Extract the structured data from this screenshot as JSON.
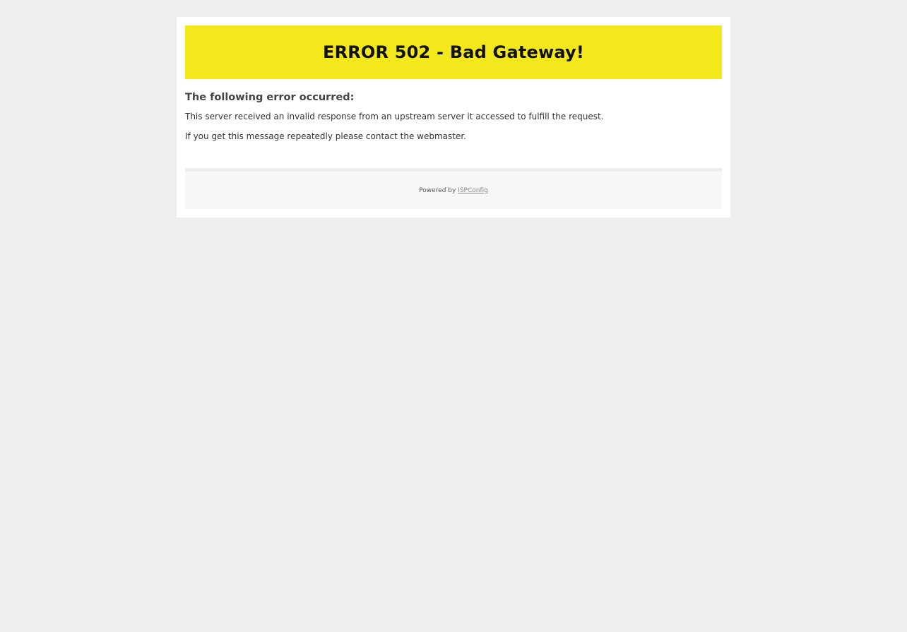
{
  "banner": {
    "title": "ERROR 502 - Bad Gateway!",
    "background_color": "#f2e81b"
  },
  "error": {
    "heading": "The following error occurred:",
    "message_1": "This server received an invalid response from an upstream server it accessed to fulfill the request.",
    "message_2": "If you get this message repeatedly please contact the webmaster."
  },
  "footer": {
    "powered_by": "Powered by",
    "link_label": "ISPConfig"
  }
}
